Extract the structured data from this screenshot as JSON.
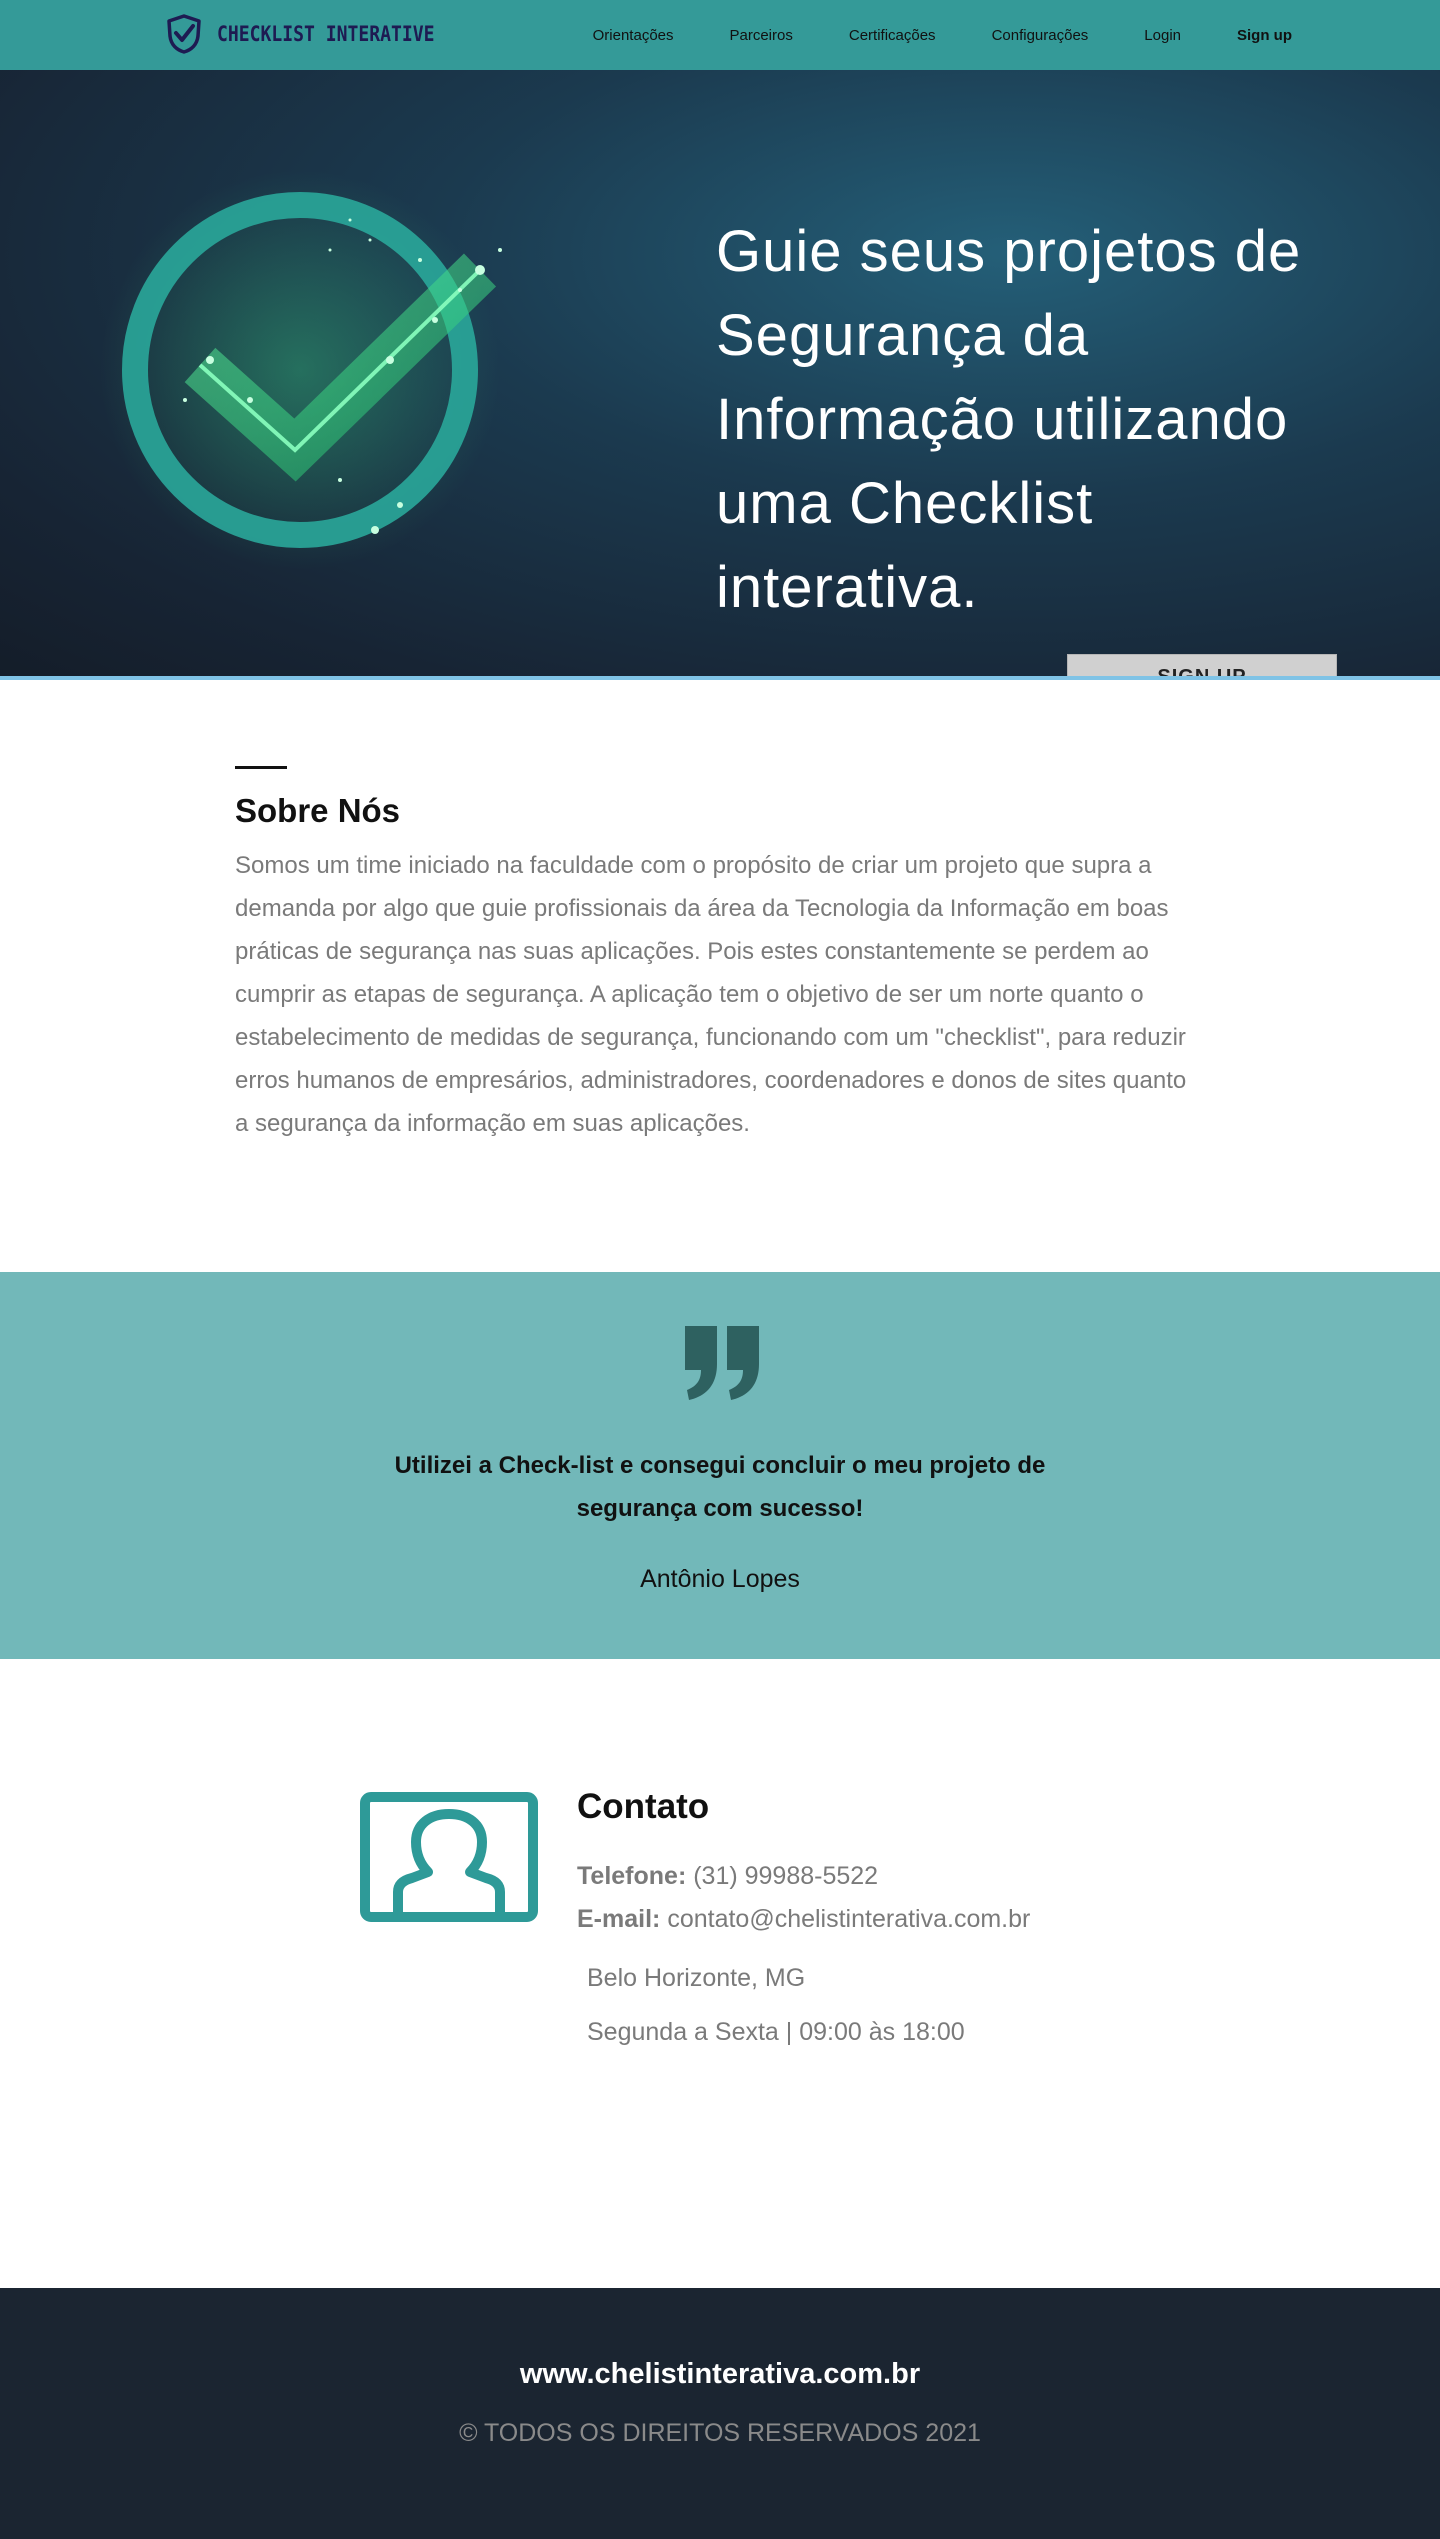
{
  "brand": {
    "name": "CHECKLIST INTERATIVE"
  },
  "nav": {
    "links": [
      {
        "label": "Orientações"
      },
      {
        "label": "Parceiros"
      },
      {
        "label": "Certificações"
      },
      {
        "label": "Configurações"
      },
      {
        "label": "Login"
      },
      {
        "label": "Sign up"
      }
    ]
  },
  "hero": {
    "title": "Guie seus projetos de Segurança da Informação utilizando uma Checklist interativa.",
    "signup_label": "SIGN UP"
  },
  "about": {
    "title": "Sobre Nós",
    "text": "Somos um time iniciado na faculdade com o propósito de criar um projeto que supra a demanda por algo que guie profissionais da área da Tecnologia da Informação em boas práticas de segurança nas suas aplicações. Pois estes constantemente se perdem ao cumprir as etapas de segurança. A aplicação tem o objetivo de ser um norte quanto o estabelecimento de medidas de segurança, funcionando com um \"checklist\", para reduzir erros humanos de empresários, administradores, coordenadores e donos de sites quanto a segurança da informação em suas aplicações."
  },
  "testimonial": {
    "quote": "Utilizei a Check-list e consegui concluir o meu projeto de segurança com sucesso!",
    "author": "Antônio Lopes"
  },
  "contact": {
    "title": "Contato",
    "phone_label": "Telefone:",
    "phone": "(31) 99988-5522",
    "email_label": "E-mail:",
    "email": "contato@chelistinterativa.com.br",
    "location": "Belo Horizonte, MG",
    "hours": "Segunda a Sexta | 09:00 às 18:00"
  },
  "footer": {
    "url": "www.chelistinterativa.com.br",
    "copyright": "© TODOS OS DIREITOS RESERVADOS 2021"
  },
  "colors": {
    "nav": "#349a98",
    "testimonial": "#72b8b9",
    "footer": "#1b2531",
    "accent": "#2e9a98"
  }
}
